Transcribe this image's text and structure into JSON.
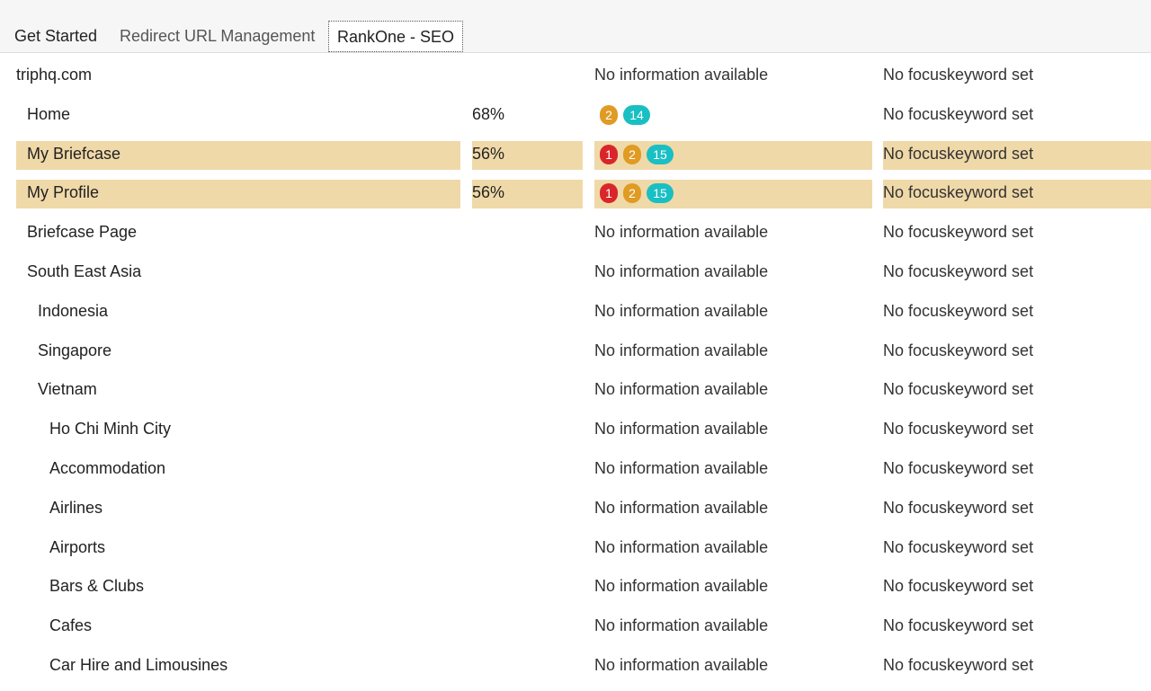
{
  "tabs": [
    {
      "label": "Get Started"
    },
    {
      "label": "Redirect URL Management"
    },
    {
      "label": "RankOne - SEO",
      "active": true
    }
  ],
  "colors": {
    "highlight": "#f0d9a8",
    "badge_red": "#d9262a",
    "badge_orange": "#df9b23",
    "badge_teal": "#19bfc3"
  },
  "rows": [
    {
      "name": "triphq.com",
      "level": 0,
      "score": "",
      "info": "No information available",
      "keyword": "No focuskeyword set"
    },
    {
      "name": "Home",
      "level": 1,
      "score": "68%",
      "badges": {
        "orange": "2",
        "teal": "14"
      },
      "keyword": "No focuskeyword set"
    },
    {
      "name": "My Briefcase",
      "level": 1,
      "score": "56%",
      "highlight": true,
      "badges": {
        "red": "1",
        "orange": "2",
        "teal": "15"
      },
      "keyword": "No focuskeyword set"
    },
    {
      "name": "My Profile",
      "level": 1,
      "score": "56%",
      "highlight": true,
      "badges": {
        "red": "1",
        "orange": "2",
        "teal": "15"
      },
      "keyword": "No focuskeyword set"
    },
    {
      "name": "Briefcase Page",
      "level": 1,
      "score": "",
      "info": "No information available",
      "keyword": "No focuskeyword set"
    },
    {
      "name": "South East Asia",
      "level": 1,
      "score": "",
      "info": "No information available",
      "keyword": "No focuskeyword set"
    },
    {
      "name": "Indonesia",
      "level": 2,
      "score": "",
      "info": "No information available",
      "keyword": "No focuskeyword set"
    },
    {
      "name": "Singapore",
      "level": 2,
      "score": "",
      "info": "No information available",
      "keyword": "No focuskeyword set"
    },
    {
      "name": "Vietnam",
      "level": 2,
      "score": "",
      "info": "No information available",
      "keyword": "No focuskeyword set"
    },
    {
      "name": "Ho Chi Minh City",
      "level": 3,
      "score": "",
      "info": "No information available",
      "keyword": "No focuskeyword set"
    },
    {
      "name": "Accommodation",
      "level": 3,
      "score": "",
      "info": "No information available",
      "keyword": "No focuskeyword set"
    },
    {
      "name": "Airlines",
      "level": 3,
      "score": "",
      "info": "No information available",
      "keyword": "No focuskeyword set"
    },
    {
      "name": "Airports",
      "level": 3,
      "score": "",
      "info": "No information available",
      "keyword": "No focuskeyword set"
    },
    {
      "name": "Bars & Clubs",
      "level": 3,
      "score": "",
      "info": "No information available",
      "keyword": "No focuskeyword set"
    },
    {
      "name": "Cafes",
      "level": 3,
      "score": "",
      "info": "No information available",
      "keyword": "No focuskeyword set"
    },
    {
      "name": "Car Hire and Limousines",
      "level": 3,
      "score": "",
      "info": "No information available",
      "keyword": "No focuskeyword set"
    }
  ]
}
